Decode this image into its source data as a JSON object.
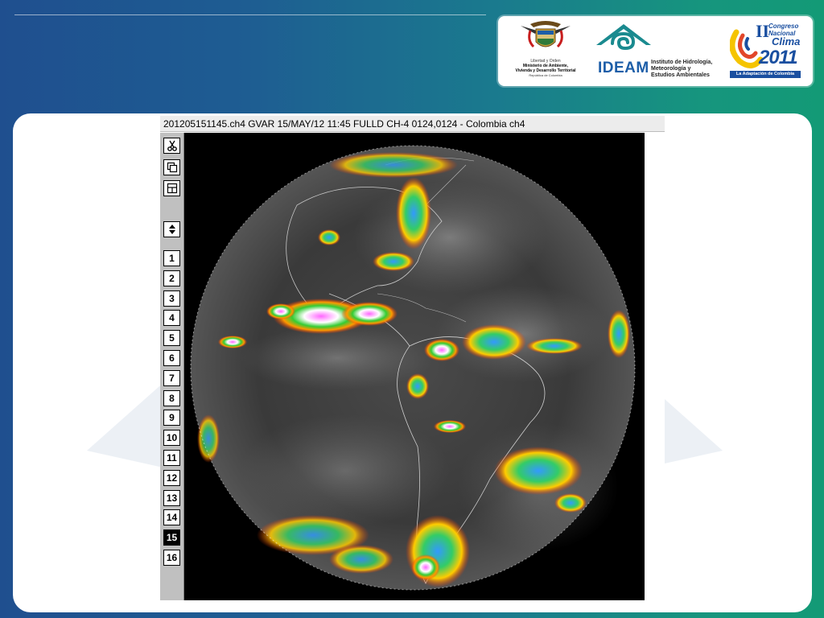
{
  "window": {
    "title": "201205151145.ch4 GVAR 15/MAY/12 11:45 FULLD CH-4 0124,0124 - Colombia ch4"
  },
  "toolbar": {
    "numbers": [
      "1",
      "2",
      "3",
      "4",
      "5",
      "6",
      "7",
      "8",
      "9",
      "10",
      "11",
      "12",
      "13",
      "14",
      "15",
      "16"
    ],
    "active": "15"
  },
  "logos": {
    "ministry": {
      "line1": "Libertad y Orden",
      "line2": "Ministerio de Ambiente,",
      "line3": "Vivienda y Desarrollo Territorial",
      "line4": "República de Colombia"
    },
    "ideam": {
      "name": "IDEAM",
      "line1": "Instituto de Hidrología,",
      "line2": "Meteorología y",
      "line3": "Estudios Ambientales"
    },
    "congreso": {
      "numeral": "II",
      "line1": "Congreso",
      "line2": "Nacional",
      "line3": "Clima",
      "year": "2011",
      "tagline": "La Adaptación de Colombia"
    }
  },
  "colors": {
    "ideam_teal": "#1a8a8f",
    "ideam_blue": "#1d5ea8",
    "congreso_blue": "#1a4fa0",
    "congreso_yellow": "#f5c400"
  }
}
